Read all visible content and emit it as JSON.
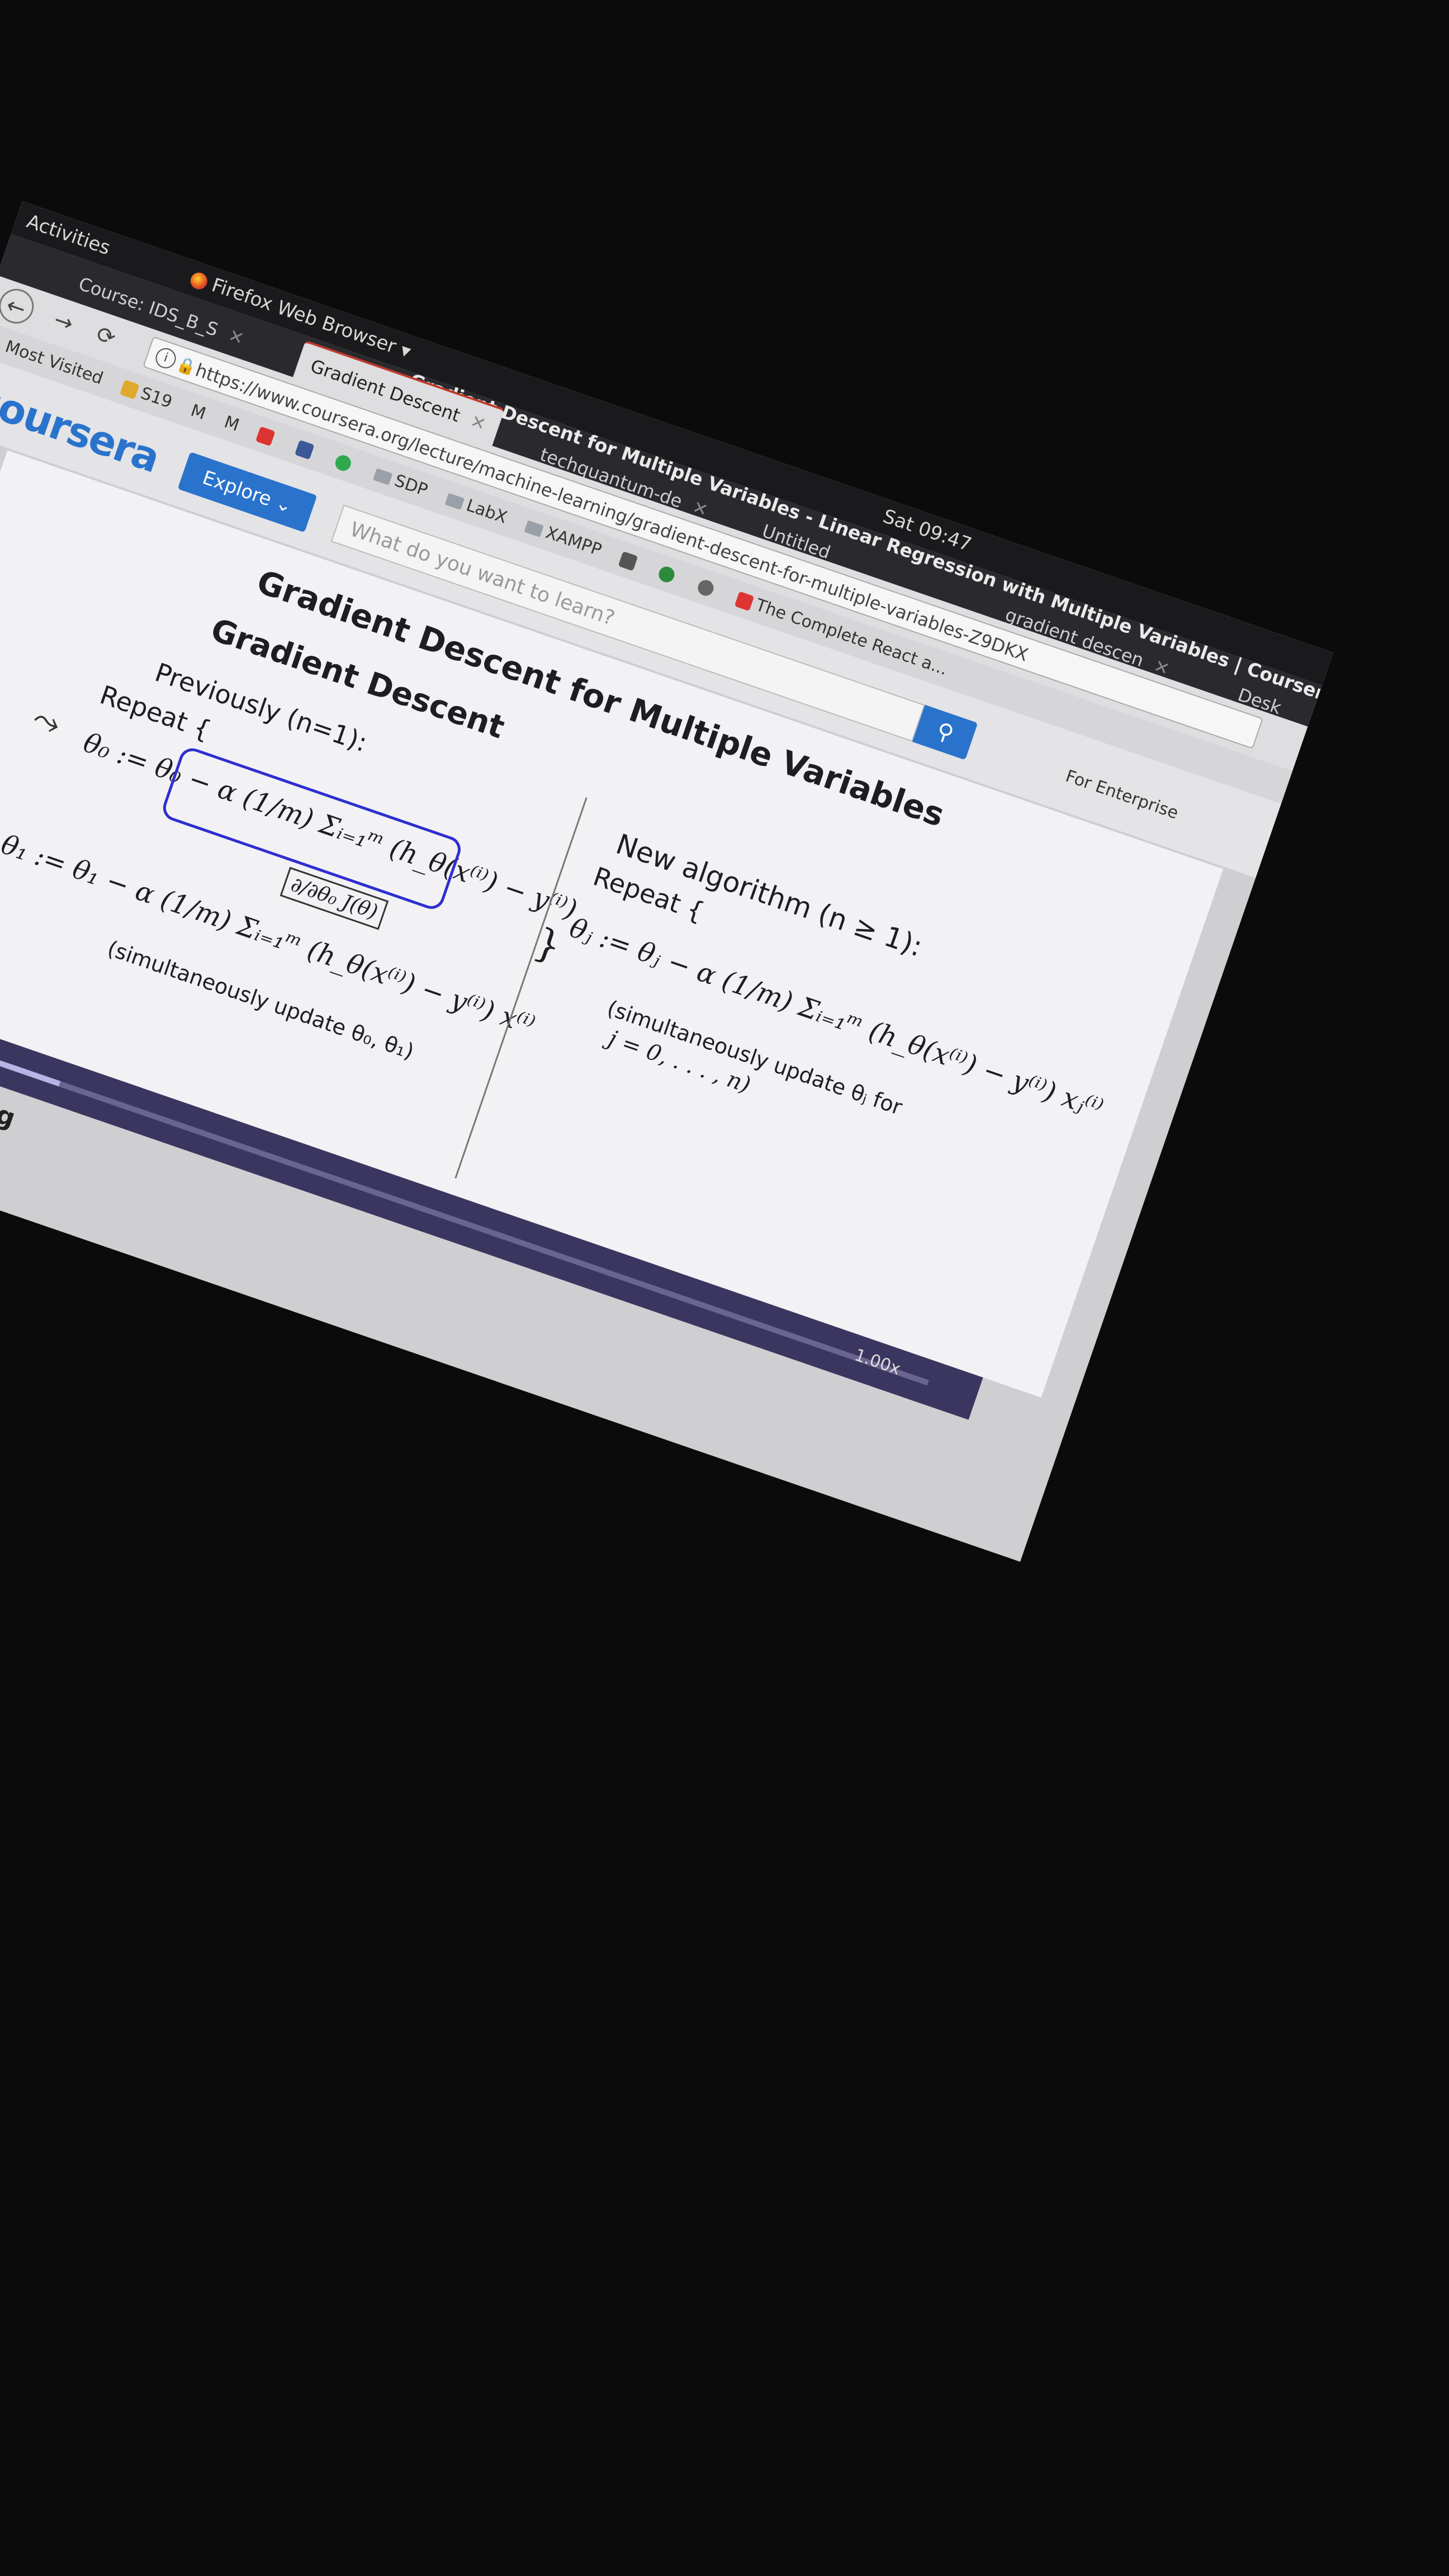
{
  "topbar": {
    "activities": "Activities",
    "app_menu": "Firefox Web Browser ▾",
    "clock": "Sat 09:47"
  },
  "window": {
    "title": "Gradient Descent for Multiple Variables - Linear Regression with Multiple Variables | Coursera - M"
  },
  "tabs": [
    {
      "label": "Course: IDS_B_S"
    },
    {
      "label": "Gradient Descent"
    },
    {
      "label": "techquantum-de"
    },
    {
      "label": "Untitled"
    },
    {
      "label": "gradient descen"
    },
    {
      "label": "Desk"
    }
  ],
  "nav": {
    "url": "https://www.coursera.org/lecture/machine-learning/gradient-descent-for-multiple-variables-Z9DKX",
    "most_visited": "Most Visited"
  },
  "bookmarks": [
    {
      "label": "Most Visited"
    },
    {
      "label": "S19"
    },
    {
      "label": "SDP"
    },
    {
      "label": "LabX"
    },
    {
      "label": "XAMPP"
    },
    {
      "label": "The Complete React a..."
    }
  ],
  "coursera": {
    "logo": "coursera",
    "explore": "Explore",
    "search_placeholder": "What do you want to learn?",
    "enterprise": "For Enterprise"
  },
  "slide": {
    "title": "Gradient Descent for Multiple Variables",
    "subtitle": "Gradient Descent",
    "previously": "Previously (n=1):",
    "repeat_left": "Repeat {",
    "theta0": "θ₀ := θ₀ − α (1/m) Σᵢ₌₁ᵐ (h_θ(x⁽ⁱ⁾) − y⁽ⁱ⁾)",
    "partial": "∂/∂θ₀ J(θ)",
    "theta1": "θ₁ := θ₁ − α (1/m) Σᵢ₌₁ᵐ (h_θ(x⁽ⁱ⁾) − y⁽ⁱ⁾) x⁽ⁱ⁾",
    "simul_left": "(simultaneously update θ₀, θ₁)",
    "close_brace": "}",
    "new_algo": "New algorithm (n ≥ 1):",
    "repeat_right": "Repeat {",
    "thetaj": "θⱼ := θⱼ − α (1/m) Σᵢ₌₁ᵐ (h_θ(x⁽ⁱ⁾) − y⁽ⁱ⁾) xⱼ⁽ⁱ⁾",
    "simul_right": "(simultaneously update θⱼ for",
    "j_range": "j = 0, . . . , n)"
  },
  "player": {
    "progress_fraction": 0.17,
    "speed": "1.00x"
  },
  "course": {
    "label": "Machine Learning"
  }
}
